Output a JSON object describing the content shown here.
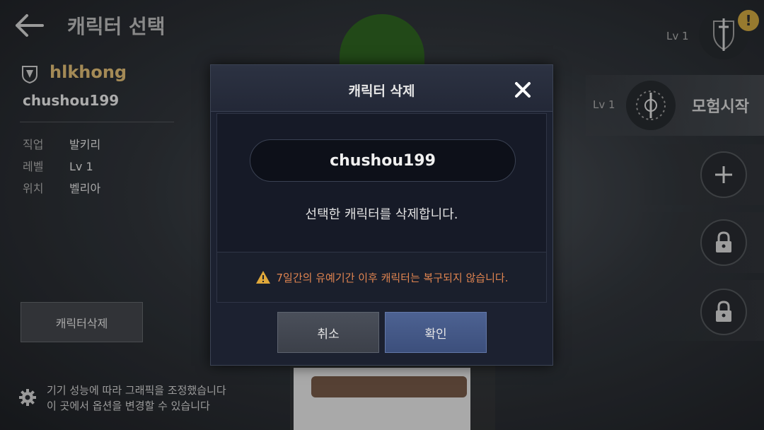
{
  "header": {
    "title": "캐릭터 선택"
  },
  "character": {
    "family_name": "hlkhong",
    "name": "chushou199",
    "info": [
      {
        "key": "직업",
        "value": "발키리"
      },
      {
        "key": "레벨",
        "value": "Lv 1"
      },
      {
        "key": "위치",
        "value": "벨리아"
      }
    ]
  },
  "left_panel": {
    "delete_button": "캐릭터삭제"
  },
  "settings_note": {
    "line1": "기기 성능에 따라 그래픽을 조정했습니다",
    "line2": "이 곳에서 옵션을 변경할 수 있습니다"
  },
  "slots": {
    "top_level": "Lv 1",
    "selected_level": "Lv 1",
    "start_label": "모험시작",
    "alert_badge": "!"
  },
  "modal": {
    "title": "캐릭터 삭제",
    "close_symbol": "✕",
    "name": "chushou199",
    "message": "선택한 캐릭터를 삭제합니다.",
    "warning": "7일간의 유예기간 이후 캐릭터는 복구되지 않습니다.",
    "cancel_label": "취소",
    "confirm_label": "확인"
  },
  "colors": {
    "warning": "#e08450",
    "family_name": "#c8a96a",
    "confirm_button": "#4d6292"
  }
}
